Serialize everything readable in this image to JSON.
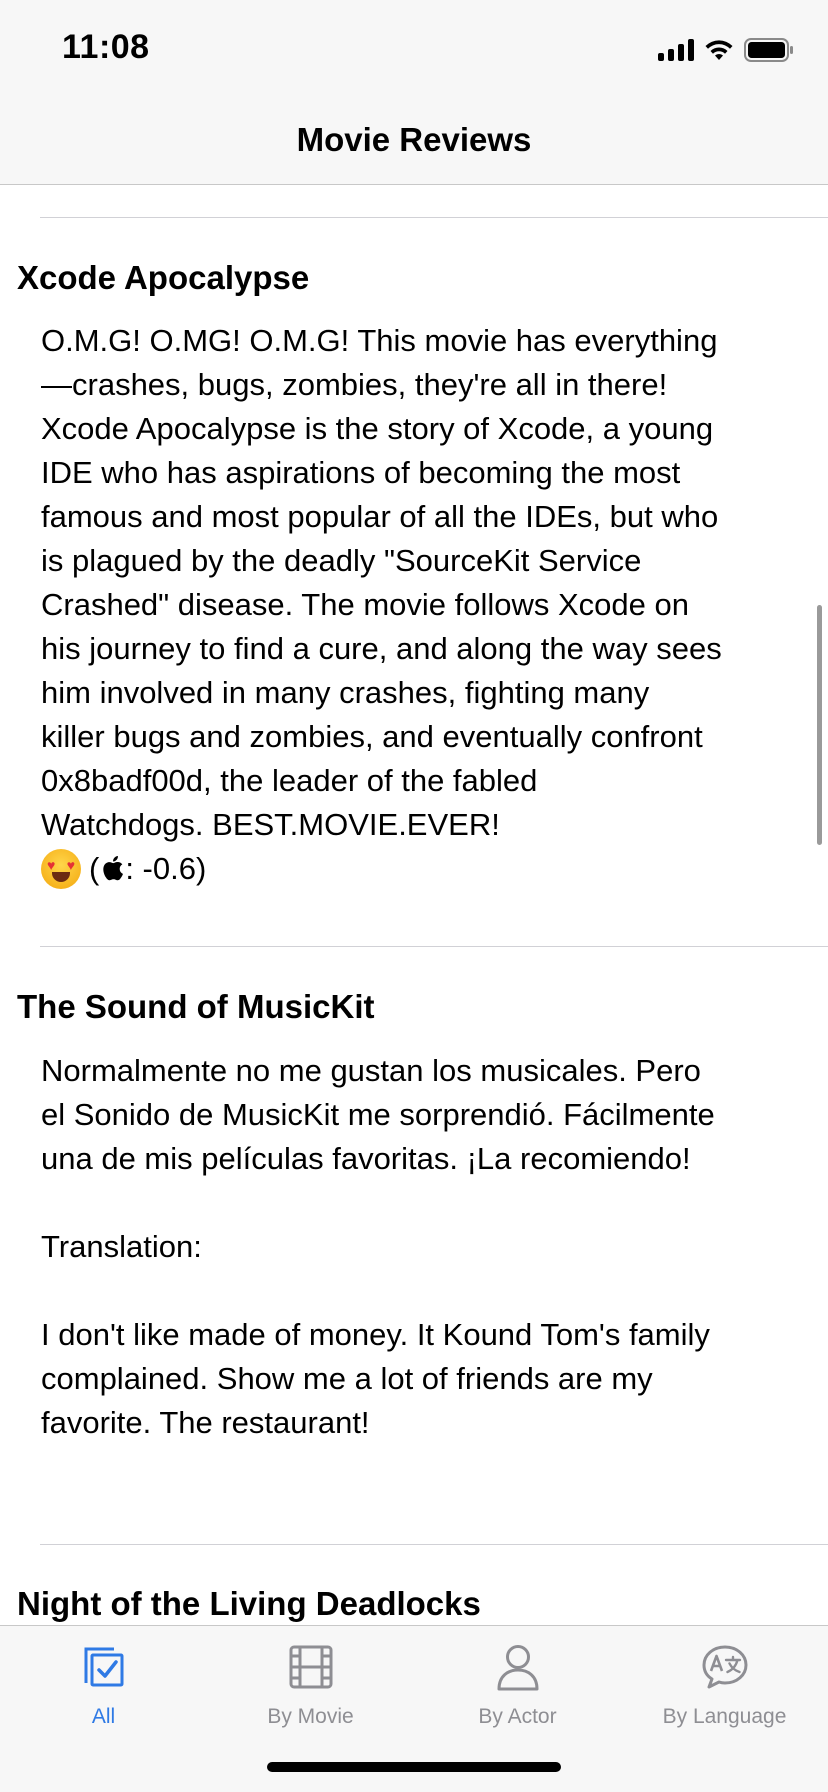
{
  "status_bar": {
    "time": "11:08"
  },
  "nav": {
    "title": "Movie Reviews"
  },
  "reviews": [
    {
      "title": "Xcode Apocalypse",
      "text": "O.M.G! O.MG! O.M.G! This movie has everything\n—crashes, bugs, zombies, they're all in there!\nXcode Apocalypse is the story of Xcode, a young\nIDE who has aspirations of becoming the most\nfamous and most popular of all the IDEs, but who\nis plagued by the deadly \"SourceKit Service\nCrashed\" disease. The movie follows Xcode on\nhis journey to find a cure, and along the way sees\nhim involved in many crashes, fighting many\nkiller bugs and zombies, and eventually confront\n0x8badf00d, the leader of the fabled\nWatchdogs. BEST.MOVIE.EVER!",
      "sentiment_emoji": "heart-eyes-emoji",
      "sentiment_score": "(: -0.6)"
    },
    {
      "title": "The Sound of MusicKit",
      "text": "Normalmente no me gustan los musicales. Pero\nel Sonido de MusicKit me sorprendió. Fácilmente\nuna de mis películas favoritas. ¡La recomiendo!\n\nTranslation:\n\nI don't like made of money. It Kound Tom's family\ncomplained. Show me a lot of friends are my\nfavorite. The restaurant!"
    },
    {
      "title": "Night of the Living Deadlocks"
    }
  ],
  "tabs": [
    {
      "label": "All",
      "icon": "checklist-icon",
      "active": true
    },
    {
      "label": "By Movie",
      "icon": "film-icon",
      "active": false
    },
    {
      "label": "By Actor",
      "icon": "person-icon",
      "active": false
    },
    {
      "label": "By Language",
      "icon": "translate-icon",
      "active": false
    }
  ],
  "colors": {
    "accent": "#2f7ae5",
    "inactive": "#8e8e93",
    "bar_background": "#f7f7f7"
  }
}
